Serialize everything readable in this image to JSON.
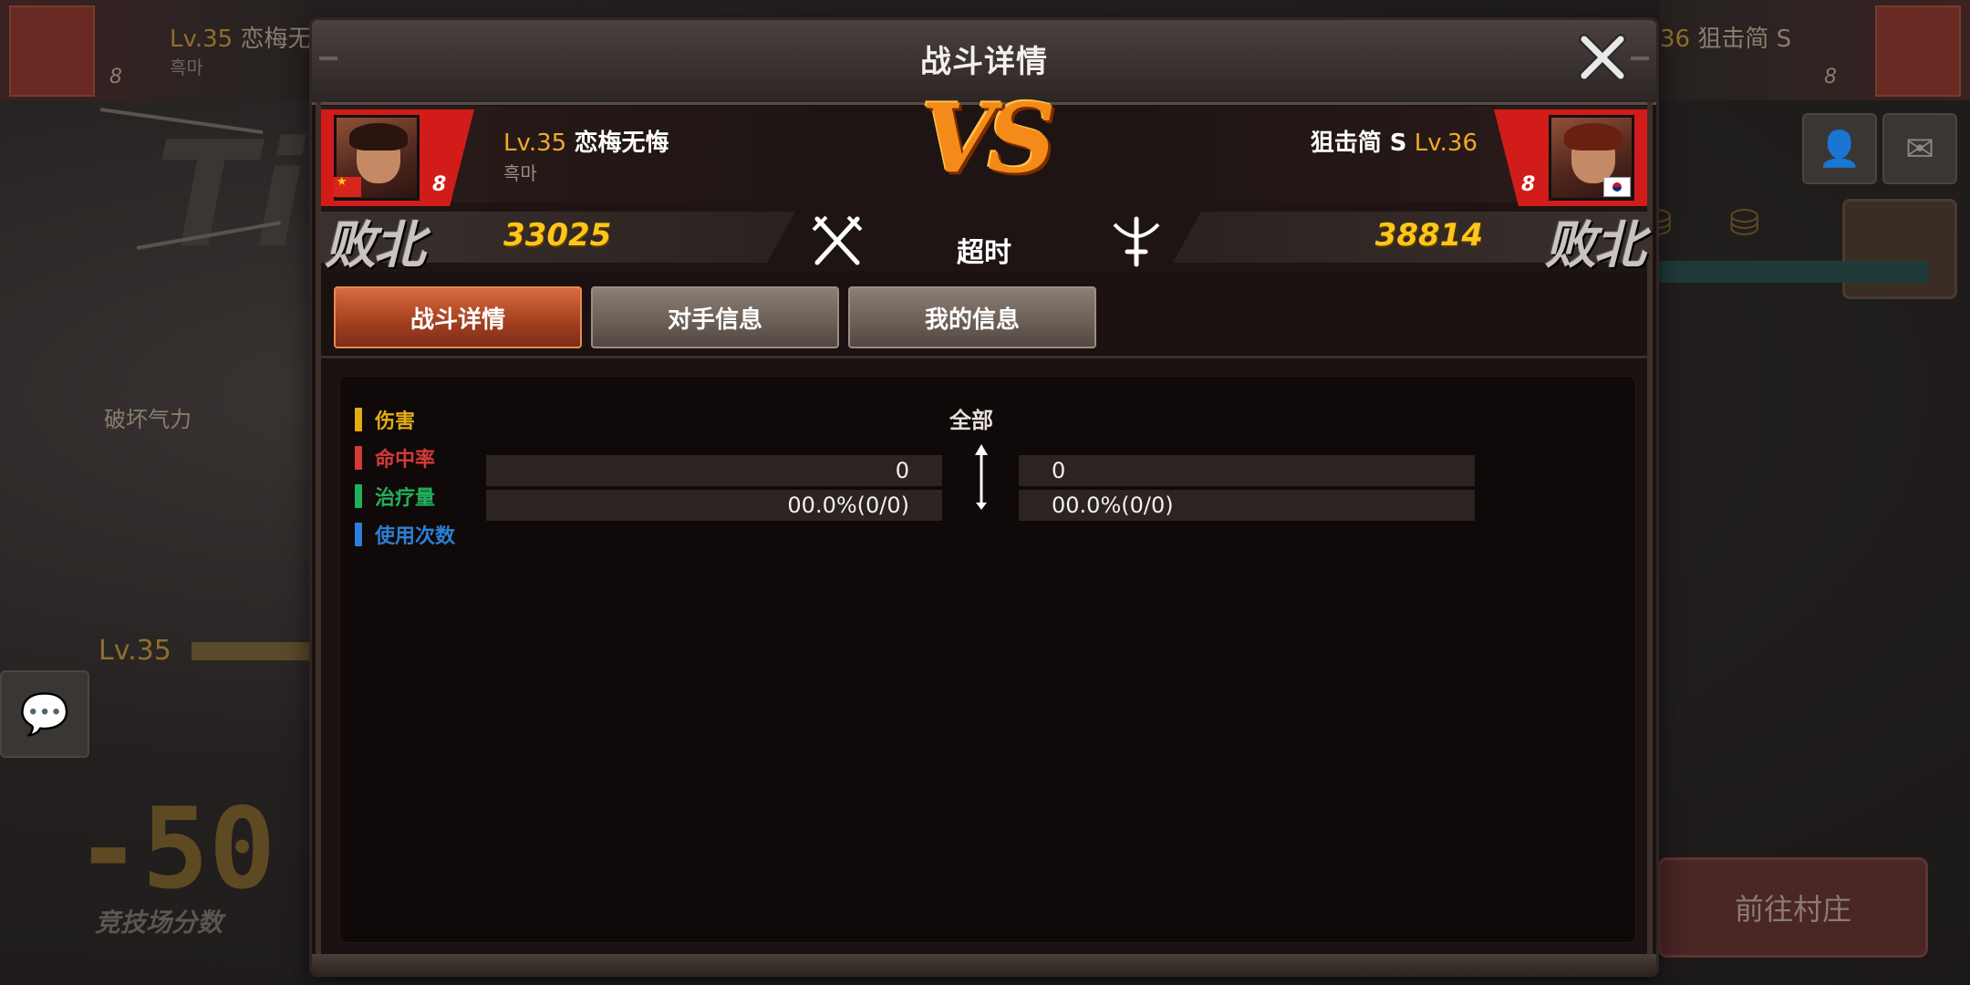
{
  "background": {
    "left_player": {
      "level": "Lv.35",
      "name": "恋梅无",
      "guild": "흑마",
      "rank": "8"
    },
    "right_player": {
      "level": "36",
      "name": "狙击简 S",
      "rank": "8"
    },
    "destroy_label": "破坏气力",
    "level_label": "Lv.35",
    "score_change": "-50",
    "arena_score_label": "竞技场分数",
    "go_village_label": "前往村庄",
    "icons": [
      "add-friend-icon",
      "mail-icon",
      "chat-icon",
      "coin-stack-icon",
      "chest-icon"
    ]
  },
  "modal": {
    "title": "战斗详情",
    "close_icon": "close-icon"
  },
  "match": {
    "left": {
      "level": "Lv.35",
      "name": "恋梅无悔",
      "guild": "흑마",
      "rank": "8",
      "result": "败北",
      "score": "33025",
      "flag": "china-flag"
    },
    "right": {
      "level": "Lv.36",
      "name": "狙击简 S",
      "rank": "8",
      "result": "败北",
      "score": "38814",
      "flag": "korea-flag"
    },
    "vs": "VS",
    "outcome": "超时",
    "left_weapon_icon": "crossed-swords-icon",
    "right_weapon_icon": "crossbow-icon"
  },
  "tabs": [
    {
      "label": "战斗详情",
      "active": true
    },
    {
      "label": "对手信息",
      "active": false
    },
    {
      "label": "我的信息",
      "active": false
    }
  ],
  "legend": [
    {
      "label": "伤害",
      "color": "#e3ad12"
    },
    {
      "label": "命中率",
      "color": "#d53a3a"
    },
    {
      "label": "治疗量",
      "color": "#21b05a"
    },
    {
      "label": "使用次数",
      "color": "#2c7fd6"
    }
  ],
  "stats": {
    "all_label": "全部",
    "rows": [
      {
        "left": "0",
        "right": "0"
      },
      {
        "left": "00.0%(0/0)",
        "right": "00.0%(0/0)"
      }
    ]
  }
}
